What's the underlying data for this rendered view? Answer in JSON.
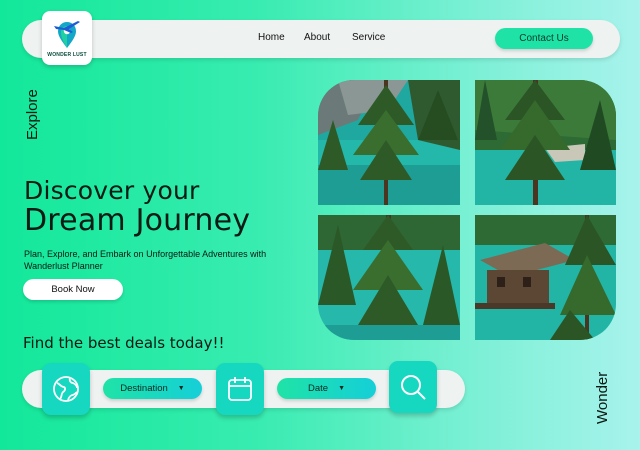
{
  "brand": {
    "name": "WONDER LUST",
    "icon": "map-pin-plane-logo"
  },
  "nav": {
    "links": [
      "Home",
      "About",
      "Service"
    ],
    "contact_label": "Contact Us"
  },
  "side": {
    "left": "Explore",
    "right": "Wonder"
  },
  "hero": {
    "line1": "Discover your",
    "line2": "Dream Journey",
    "subtitle": "Plan, Explore, and Embark on Unforgettable Adventures with Wanderlust Planner",
    "cta_label": "Book Now"
  },
  "deals": {
    "title": "Find the best deals today!!",
    "destination_label": "Destination",
    "date_label": "Date",
    "icons": [
      "globe-icon",
      "calendar-icon",
      "search-icon"
    ]
  },
  "gallery": {
    "description_icons": [
      "lake-forest-photo",
      "lake-shore-photo",
      "pine-tree-photo",
      "boathouse-photo"
    ]
  },
  "colors": {
    "accent": "#1fe3a6",
    "tile": "#16d8c0",
    "bg_start": "#12e89a",
    "bg_end": "#a8f3ec"
  }
}
